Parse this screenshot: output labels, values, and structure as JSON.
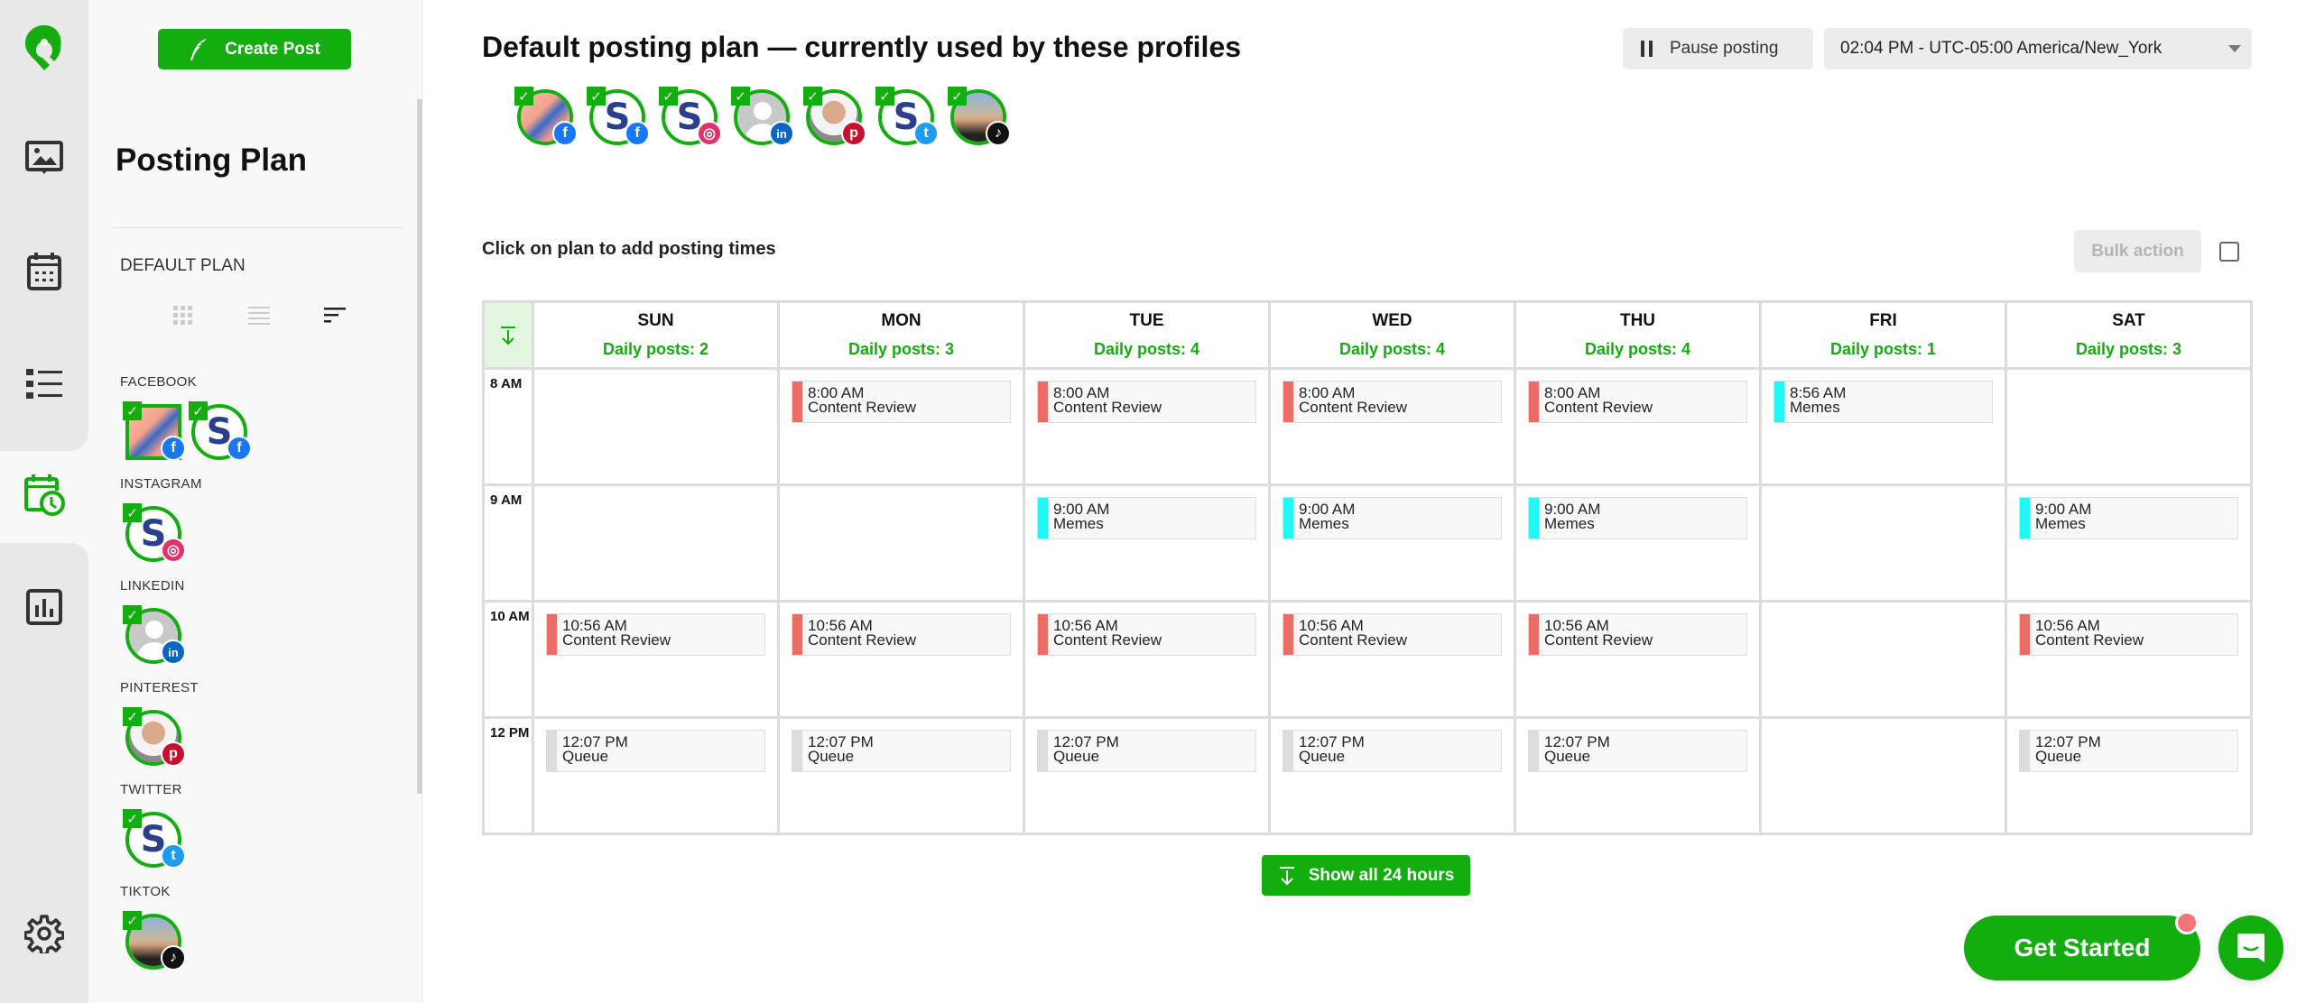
{
  "brand": {
    "accent": "#13ad0f",
    "logo_icon": "location-pin-logo-icon"
  },
  "rail": {
    "items": [
      {
        "name": "media-library",
        "icon": "image-comment-icon"
      },
      {
        "name": "calendar",
        "icon": "calendar-icon"
      },
      {
        "name": "posts-list",
        "icon": "list-icon"
      },
      {
        "name": "posting-plan",
        "icon": "calendar-clock-icon",
        "active": true
      },
      {
        "name": "analytics",
        "icon": "bar-chart-icon"
      },
      {
        "name": "settings",
        "icon": "gear-icon"
      }
    ]
  },
  "panel": {
    "create_post_label": "Create Post",
    "title": "Posting Plan",
    "plan_label": "DEFAULT PLAN",
    "view_modes": [
      "grid",
      "list",
      "sorted"
    ],
    "active_view": "sorted",
    "networks": [
      {
        "label": "FACEBOOK",
        "profiles": [
          {
            "avatar": "illustration",
            "network": "facebook",
            "selected": true
          },
          {
            "avatar": "S-logo",
            "network": "facebook",
            "selected": true
          }
        ]
      },
      {
        "label": "INSTAGRAM",
        "profiles": [
          {
            "avatar": "S-logo",
            "network": "instagram",
            "selected": true
          }
        ]
      },
      {
        "label": "LINKEDIN",
        "profiles": [
          {
            "avatar": "placeholder",
            "network": "linkedin",
            "selected": true
          }
        ]
      },
      {
        "label": "PINTEREST",
        "profiles": [
          {
            "avatar": "portrait",
            "network": "pinterest",
            "selected": true
          }
        ]
      },
      {
        "label": "TWITTER",
        "profiles": [
          {
            "avatar": "S-logo",
            "network": "twitter",
            "selected": true
          }
        ]
      },
      {
        "label": "TIKTOK",
        "profiles": [
          {
            "avatar": "selfie",
            "network": "tiktok",
            "selected": true
          }
        ]
      }
    ]
  },
  "header": {
    "title": "Default posting plan — currently used by these profiles",
    "pause_label": "Pause posting",
    "timezone_value": "02:04 PM - UTC-05:00 America/New_York"
  },
  "plan": {
    "hint": "Click on plan to add posting times",
    "bulk_action_label": "Bulk action",
    "show_all_label": "Show all 24 hours",
    "categories": {
      "Content Review": "#eb6b65",
      "Memes": "#22f7f7",
      "Queue": "#dcdcdc"
    },
    "days": [
      {
        "name": "SUN",
        "daily": "Daily posts: 2"
      },
      {
        "name": "MON",
        "daily": "Daily posts: 3"
      },
      {
        "name": "TUE",
        "daily": "Daily posts: 4"
      },
      {
        "name": "WED",
        "daily": "Daily posts: 4"
      },
      {
        "name": "THU",
        "daily": "Daily posts: 4"
      },
      {
        "name": "FRI",
        "daily": "Daily posts: 1"
      },
      {
        "name": "SAT",
        "daily": "Daily posts: 3"
      }
    ],
    "hours": [
      {
        "label": "8 AM",
        "slots": [
          null,
          {
            "time": "8:00 AM",
            "category": "Content Review"
          },
          {
            "time": "8:00 AM",
            "category": "Content Review"
          },
          {
            "time": "8:00 AM",
            "category": "Content Review"
          },
          {
            "time": "8:00 AM",
            "category": "Content Review"
          },
          {
            "time": "8:56 AM",
            "category": "Memes"
          },
          null
        ]
      },
      {
        "label": "9 AM",
        "slots": [
          null,
          null,
          {
            "time": "9:00 AM",
            "category": "Memes"
          },
          {
            "time": "9:00 AM",
            "category": "Memes"
          },
          {
            "time": "9:00 AM",
            "category": "Memes"
          },
          null,
          {
            "time": "9:00 AM",
            "category": "Memes"
          }
        ]
      },
      {
        "label": "10 AM",
        "slots": [
          {
            "time": "10:56 AM",
            "category": "Content Review"
          },
          {
            "time": "10:56 AM",
            "category": "Content Review"
          },
          {
            "time": "10:56 AM",
            "category": "Content Review"
          },
          {
            "time": "10:56 AM",
            "category": "Content Review"
          },
          {
            "time": "10:56 AM",
            "category": "Content Review"
          },
          null,
          {
            "time": "10:56 AM",
            "category": "Content Review"
          }
        ]
      },
      {
        "label": "12 PM",
        "slots": [
          {
            "time": "12:07 PM",
            "category": "Queue"
          },
          {
            "time": "12:07 PM",
            "category": "Queue"
          },
          {
            "time": "12:07 PM",
            "category": "Queue"
          },
          {
            "time": "12:07 PM",
            "category": "Queue"
          },
          {
            "time": "12:07 PM",
            "category": "Queue"
          },
          null,
          {
            "time": "12:07 PM",
            "category": "Queue"
          }
        ]
      }
    ]
  },
  "header_profiles": [
    {
      "avatar": "illustration",
      "network": "facebook"
    },
    {
      "avatar": "S-logo",
      "network": "facebook"
    },
    {
      "avatar": "S-logo",
      "network": "instagram"
    },
    {
      "avatar": "placeholder",
      "network": "linkedin"
    },
    {
      "avatar": "portrait",
      "network": "pinterest"
    },
    {
      "avatar": "S-logo",
      "network": "twitter"
    },
    {
      "avatar": "selfie",
      "network": "tiktok"
    }
  ],
  "network_colors": {
    "facebook": "#1877f2",
    "instagram": "#e1306c",
    "linkedin": "#0a66c2",
    "pinterest": "#c8102e",
    "twitter": "#1d9bf0",
    "tiktok": "#111111"
  },
  "network_glyphs": {
    "facebook": "f",
    "instagram": "◎",
    "linkedin": "in",
    "pinterest": "p",
    "twitter": "t",
    "tiktok": "♪"
  },
  "footer": {
    "get_started_label": "Get Started"
  }
}
